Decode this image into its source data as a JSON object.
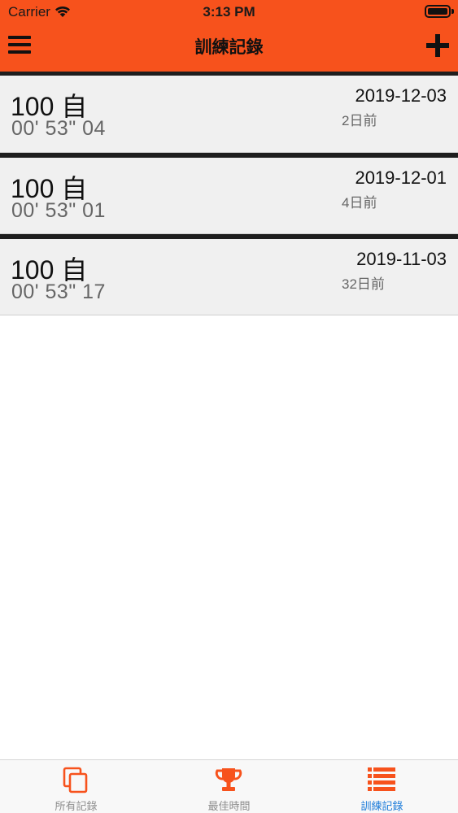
{
  "status_bar": {
    "carrier": "Carrier",
    "time": "3:13 PM"
  },
  "nav": {
    "title": "訓練記錄",
    "left_icon": "hamburger-menu-icon",
    "right_icon": "plus-icon"
  },
  "records": [
    {
      "event": "100 自",
      "duration": "00' 53\" 04",
      "date": "2019-12-03",
      "ago": "2日前"
    },
    {
      "event": "100 自",
      "duration": "00' 53\" 01",
      "date": "2019-12-01",
      "ago": "4日前"
    },
    {
      "event": "100 自",
      "duration": "00' 53\" 17",
      "date": "2019-11-03",
      "ago": "32日前"
    }
  ],
  "tabs": [
    {
      "label": "所有記錄",
      "icon": "copy-icon",
      "active": false
    },
    {
      "label": "最佳時間",
      "icon": "trophy-icon",
      "active": false
    },
    {
      "label": "訓練記錄",
      "icon": "list-icon",
      "active": true
    }
  ],
  "colors": {
    "accent": "#f7521c",
    "tab_active": "#1a7ad9",
    "tab_inactive": "#8e8e8e"
  }
}
